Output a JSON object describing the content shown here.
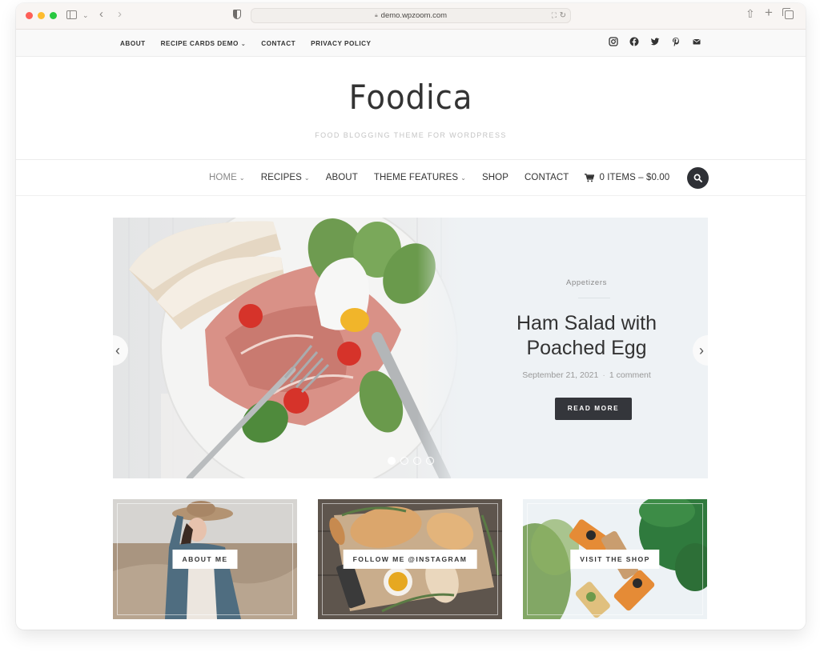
{
  "browser": {
    "url": "demo.wpzoom.com",
    "traffic_lights": [
      "close",
      "minimize",
      "zoom"
    ],
    "icons": {
      "sidebar": "sidebar-icon",
      "back": "chevron-left-icon",
      "forward": "chevron-right-icon",
      "privacy": "shield-icon",
      "lock": "lock-icon",
      "translate": "translate-icon",
      "reload": "reload-icon",
      "share": "share-icon",
      "new_tab": "plus-icon",
      "tabs": "tabs-overview-icon"
    }
  },
  "topbar": {
    "menu": [
      {
        "label": "ABOUT",
        "has_dropdown": false
      },
      {
        "label": "RECIPE CARDS DEMO",
        "has_dropdown": true
      },
      {
        "label": "CONTACT",
        "has_dropdown": false
      },
      {
        "label": "PRIVACY POLICY",
        "has_dropdown": false
      }
    ],
    "social": [
      "instagram",
      "facebook",
      "twitter",
      "pinterest",
      "email"
    ]
  },
  "header": {
    "logo": "Foodica",
    "tagline": "FOOD BLOGGING THEME FOR WORDPRESS"
  },
  "mainnav": {
    "items": [
      {
        "label": "HOME",
        "has_dropdown": true,
        "active": true
      },
      {
        "label": "RECIPES",
        "has_dropdown": true,
        "active": false
      },
      {
        "label": "ABOUT",
        "has_dropdown": false,
        "active": false
      },
      {
        "label": "THEME FEATURES",
        "has_dropdown": true,
        "active": false
      },
      {
        "label": "SHOP",
        "has_dropdown": false,
        "active": false
      },
      {
        "label": "CONTACT",
        "has_dropdown": false,
        "active": false
      }
    ],
    "cart": "0 ITEMS – $0.00",
    "chevron": "⌄"
  },
  "slider": {
    "category": "Appetizers",
    "title_line1": "Ham Salad with",
    "title_line2": "Poached Egg",
    "date": "September 21, 2021",
    "separator": "·",
    "comments": "1 comment",
    "button": "READ MORE",
    "prev": "‹",
    "next": "›",
    "total_slides": 4,
    "active_slide": 1
  },
  "cards": [
    {
      "label": "ABOUT ME"
    },
    {
      "label": "FOLLOW ME @INSTAGRAM"
    },
    {
      "label": "VISIT THE SHOP"
    }
  ],
  "colors": {
    "dark_button": "#34363b",
    "slide_bg": "#eef2f5",
    "tagline": "#c4c4c4",
    "text": "#333333"
  }
}
